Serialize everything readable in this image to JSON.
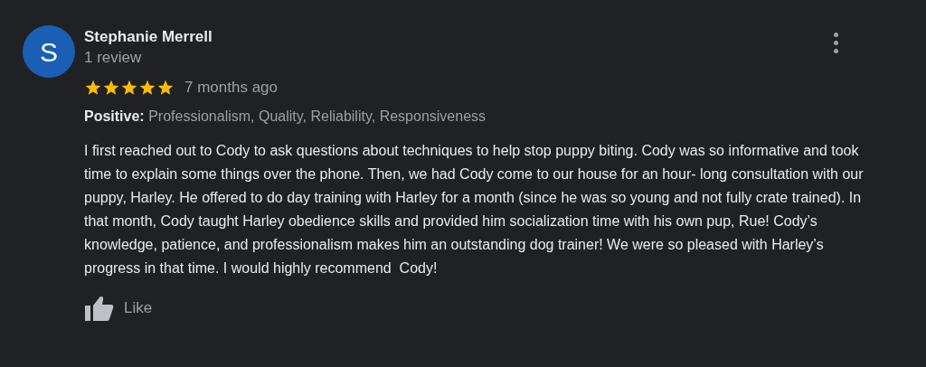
{
  "review": {
    "avatar_letter": "S",
    "author": "Stephanie Merrell",
    "review_count": "1 review",
    "stars": 5,
    "time": "7 months ago",
    "attributes": "**Positive:** Professionalism, Quality, Reliability, Responsiveness",
    "body": "I first reached out to Cody to ask questions about techniques to help stop puppy biting. Cody was so informative and took time to explain some things over the phone. Then, we had Cody come to our house for an hour- long consultation with our puppy, Harley. He offered to do day training with Harley for a month (since he was so young and not fully crate trained). In that month, Cody taught Harley obedience skills and provided him socialization time with his own pup, Rue! Cody’s knowledge, patience, and professionalism makes him an outstanding dog trainer! We were so pleased with Harley’s progress in that time. I would highly recommend  Cody!",
    "like_label": "Like"
  }
}
